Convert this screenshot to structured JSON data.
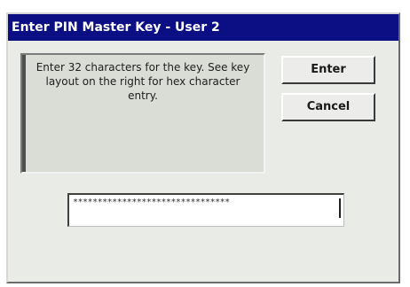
{
  "window": {
    "title": "Enter PIN Master Key - User 2"
  },
  "message": {
    "text": "Enter 32 characters for the key. See key layout on the right for hex character entry."
  },
  "buttons": {
    "enter_label": "Enter",
    "cancel_label": "Cancel"
  },
  "pin_input": {
    "value": "********************************"
  },
  "colors": {
    "titlebar": "#0c0f83",
    "window_background": "#e9ebe6"
  }
}
